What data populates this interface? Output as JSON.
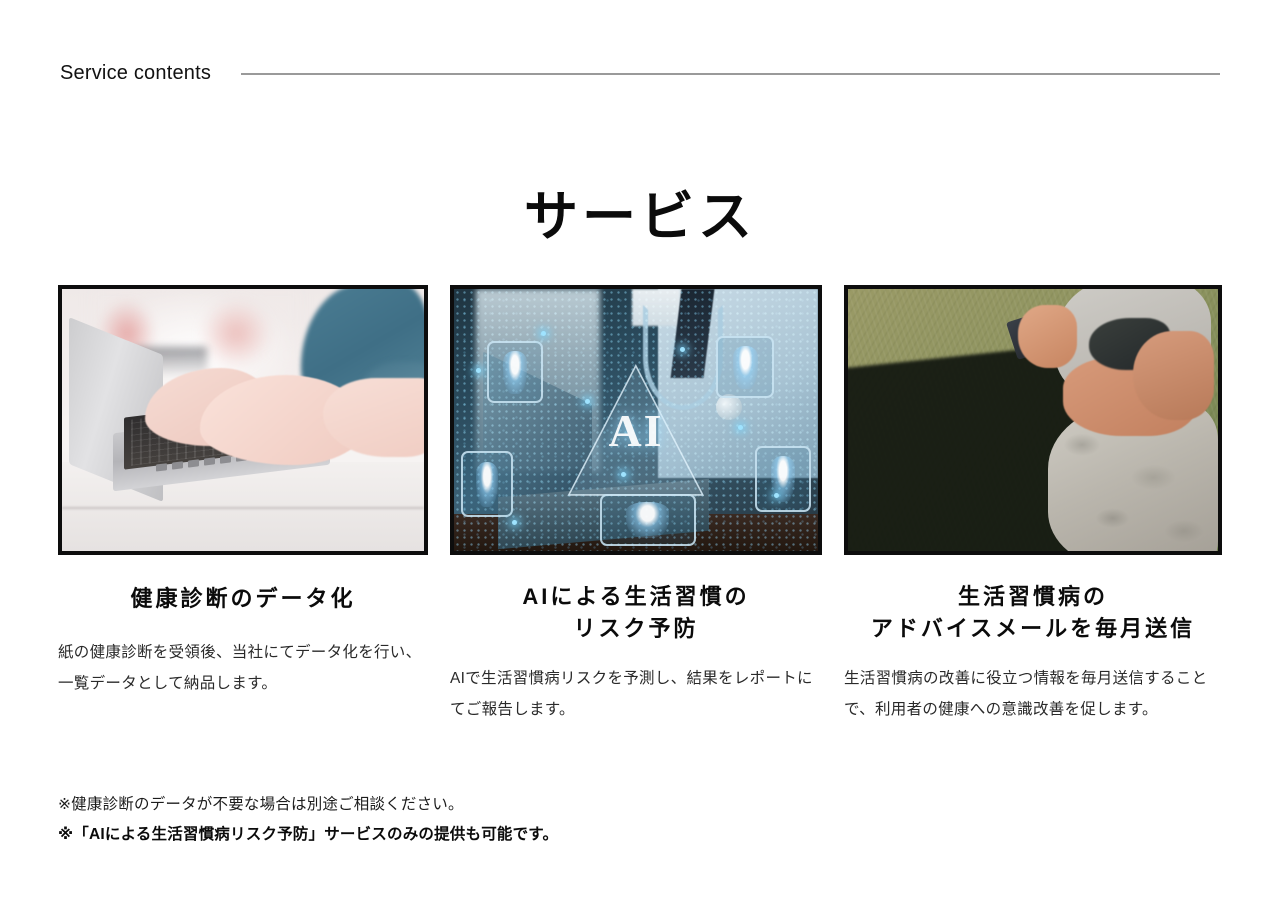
{
  "header": {
    "label": "Service contents"
  },
  "main_title": "サービス",
  "cards": [
    {
      "image_alt": "hands-typing-on-laptop",
      "title_line1": "健康診断のデータ化",
      "title_line2": "",
      "body": "紙の健康診断を受領後、当社にてデータ化を行い、一覧データとして納品します。"
    },
    {
      "image_alt": "doctor-with-ai-hologram-laptop",
      "title_line1": "AIによる生活習慣の",
      "title_line2": "リスク予防",
      "body": "AIで生活習慣病リスクを予測し、結果をレポートにてご報告します。",
      "overlay_text": "AI"
    },
    {
      "image_alt": "woman-on-grass-checking-phone",
      "title_line1": "生活習慣病の",
      "title_line2": "アドバイスメールを毎月送信",
      "body": "生活習慣病の改善に役立つ情報を毎月送信することで、利用者の健康への意識改善を促します。"
    }
  ],
  "notes": [
    "※健康診断のデータが不要な場合は別途ご相談ください。",
    "※「AIによる生活習慣病リスク予防」サービスのみの提供も可能です。"
  ],
  "colors": {
    "background": "#ffffff",
    "text": "#0b0b0b",
    "body_text": "#2a2a2a",
    "rule": "#9a9a9a",
    "frame_border": "#0d0d0d"
  }
}
